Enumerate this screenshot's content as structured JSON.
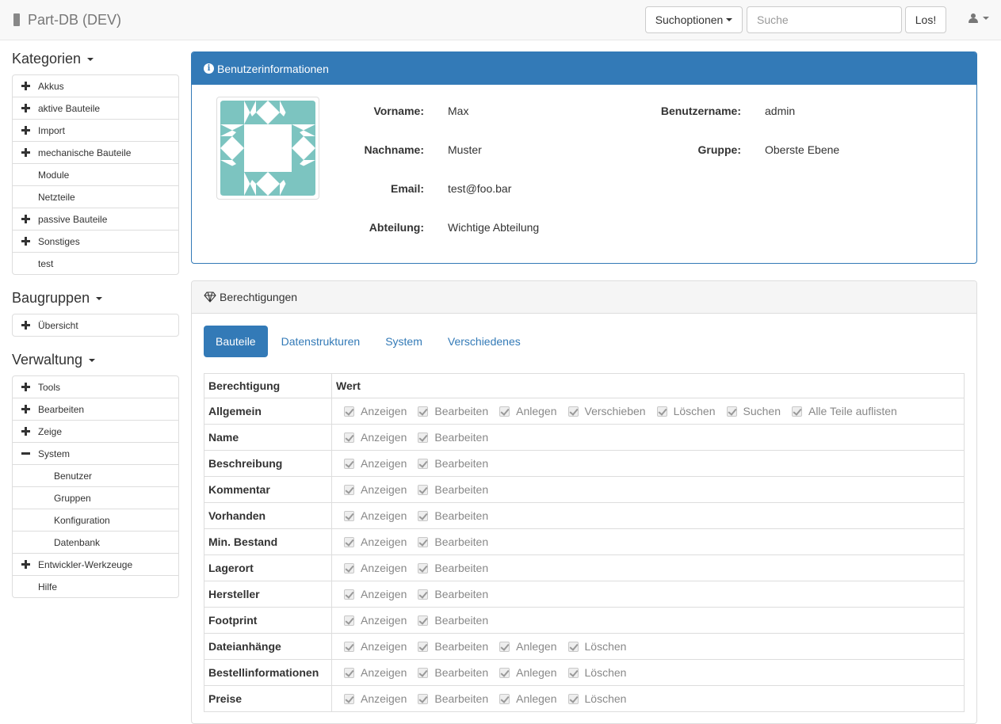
{
  "app": {
    "title": "Part-DB (DEV)"
  },
  "navbar": {
    "search_options_label": "Suchoptionen",
    "search_placeholder": "Suche",
    "search_button": "Los!"
  },
  "sidebar": {
    "categories": {
      "title": "Kategorien",
      "items": [
        {
          "label": "Akkus",
          "expandable": true
        },
        {
          "label": "aktive Bauteile",
          "expandable": true
        },
        {
          "label": "Import",
          "expandable": true
        },
        {
          "label": "mechanische Bauteile",
          "expandable": true
        },
        {
          "label": "Module",
          "expandable": false
        },
        {
          "label": "Netzteile",
          "expandable": false
        },
        {
          "label": "passive Bauteile",
          "expandable": true
        },
        {
          "label": "Sonstiges",
          "expandable": true
        },
        {
          "label": "test",
          "expandable": false
        }
      ]
    },
    "assemblies": {
      "title": "Baugruppen",
      "items": [
        {
          "label": "Übersicht",
          "expandable": true
        }
      ]
    },
    "admin": {
      "title": "Verwaltung",
      "items": [
        {
          "label": "Tools",
          "state": "collapsed",
          "level": 1
        },
        {
          "label": "Bearbeiten",
          "state": "collapsed",
          "level": 1
        },
        {
          "label": "Zeige",
          "state": "collapsed",
          "level": 1
        },
        {
          "label": "System",
          "state": "expanded",
          "level": 1
        },
        {
          "label": "Benutzer",
          "state": "leaf",
          "level": 2
        },
        {
          "label": "Gruppen",
          "state": "leaf",
          "level": 2
        },
        {
          "label": "Konfiguration",
          "state": "leaf",
          "level": 2
        },
        {
          "label": "Datenbank",
          "state": "leaf",
          "level": 2
        },
        {
          "label": "Entwickler-Werkzeuge",
          "state": "collapsed",
          "level": 1
        },
        {
          "label": "Hilfe",
          "state": "leaf",
          "level": 1
        }
      ]
    }
  },
  "user_info": {
    "title": "Benutzerinformationen",
    "firstname_label": "Vorname:",
    "firstname": "Max",
    "lastname_label": "Nachname:",
    "lastname": "Muster",
    "email_label": "Email:",
    "email": "test@foo.bar",
    "department_label": "Abteilung:",
    "department": "Wichtige Abteilung",
    "username_label": "Benutzername:",
    "username": "admin",
    "group_label": "Gruppe:",
    "group": "Oberste Ebene",
    "avatar_color": "#7cc4c0"
  },
  "permissions": {
    "title": "Berechtigungen",
    "tabs": [
      "Bauteile",
      "Datenstrukturen",
      "System",
      "Verschiedenes"
    ],
    "active_tab": "Bauteile",
    "columns": [
      "Berechtigung",
      "Wert"
    ],
    "rows": [
      {
        "name": "Allgemein",
        "values": [
          "Anzeigen",
          "Bearbeiten",
          "Anlegen",
          "Verschieben",
          "Löschen",
          "Suchen",
          "Alle Teile auflisten"
        ]
      },
      {
        "name": "Name",
        "values": [
          "Anzeigen",
          "Bearbeiten"
        ]
      },
      {
        "name": "Beschreibung",
        "values": [
          "Anzeigen",
          "Bearbeiten"
        ]
      },
      {
        "name": "Kommentar",
        "values": [
          "Anzeigen",
          "Bearbeiten"
        ]
      },
      {
        "name": "Vorhanden",
        "values": [
          "Anzeigen",
          "Bearbeiten"
        ]
      },
      {
        "name": "Min. Bestand",
        "values": [
          "Anzeigen",
          "Bearbeiten"
        ]
      },
      {
        "name": "Lagerort",
        "values": [
          "Anzeigen",
          "Bearbeiten"
        ]
      },
      {
        "name": "Hersteller",
        "values": [
          "Anzeigen",
          "Bearbeiten"
        ]
      },
      {
        "name": "Footprint",
        "values": [
          "Anzeigen",
          "Bearbeiten"
        ]
      },
      {
        "name": "Dateianhänge",
        "values": [
          "Anzeigen",
          "Bearbeiten",
          "Anlegen",
          "Löschen"
        ]
      },
      {
        "name": "Bestellinformationen",
        "values": [
          "Anzeigen",
          "Bearbeiten",
          "Anlegen",
          "Löschen"
        ]
      },
      {
        "name": "Preise",
        "values": [
          "Anzeigen",
          "Bearbeiten",
          "Anlegen",
          "Löschen"
        ]
      }
    ]
  }
}
